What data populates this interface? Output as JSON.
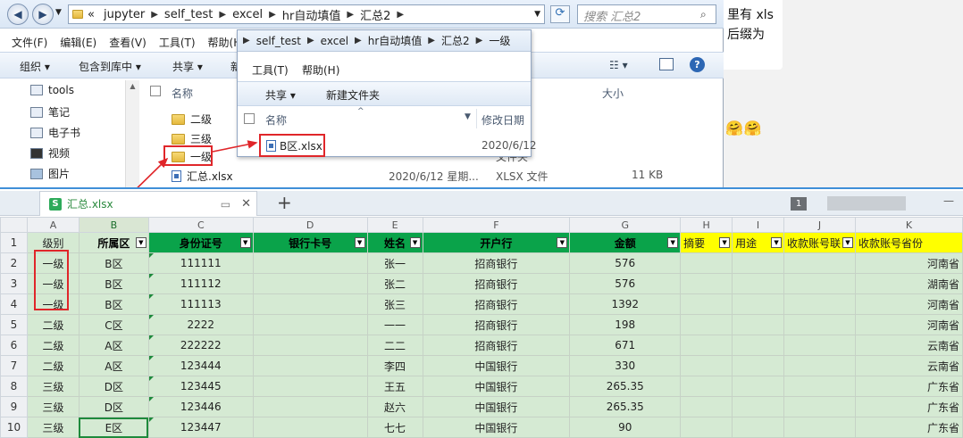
{
  "chat": {
    "bubble_lines": [
      "里有 xls",
      "后缀为"
    ],
    "emojis": "🤗🤗"
  },
  "explorer": {
    "address_prefix": "«",
    "breadcrumbs": [
      "jupyter",
      "self_test",
      "excel",
      "hr自动填值",
      "汇总2"
    ],
    "search_placeholder": "搜索 汇总2",
    "menu": [
      "文件(F)",
      "编辑(E)",
      "查看(V)",
      "工具(T)",
      "帮助(H)"
    ],
    "toolbar": [
      "组织 ▾",
      "包含到库中 ▾",
      "共享 ▾",
      "新"
    ],
    "nav_items": [
      "tools",
      "笔记",
      "电子书",
      "视频",
      "图片"
    ],
    "columns": {
      "name": "名称",
      "size": "大小"
    },
    "files": [
      {
        "name": "二级",
        "type": "folder",
        "date": "",
        "kind": "",
        "size": ""
      },
      {
        "name": "三级",
        "type": "folder",
        "date": "",
        "kind": "",
        "size": ""
      },
      {
        "name": "一级",
        "type": "folder",
        "date": "",
        "kind": "文件夹",
        "size": ""
      },
      {
        "name": "汇总.xlsx",
        "type": "xlsx",
        "date": "2020/6/12 星期...",
        "kind": "XLSX 文件",
        "size": "11 KB"
      }
    ]
  },
  "explorer2": {
    "breadcrumbs": [
      "self_test",
      "excel",
      "hr自动填值",
      "汇总2",
      "一级"
    ],
    "menu": [
      "工具(T)",
      "帮助(H)"
    ],
    "toolbar": [
      "共享 ▾",
      "新建文件夹"
    ],
    "columns": {
      "name": "名称",
      "date": "修改日期"
    },
    "file": {
      "name": "B区.xlsx",
      "date": "2020/6/12"
    }
  },
  "wps": {
    "tab_label": "汇总.xlsx",
    "add_tab": "+",
    "page_badge": "1",
    "col_letters": [
      "A",
      "B",
      "C",
      "D",
      "E",
      "F",
      "G",
      "H",
      "I",
      "J",
      "K"
    ],
    "headers": [
      "级别",
      "所属区",
      "身份证号",
      "银行卡号",
      "姓名",
      "开户行",
      "金额",
      "摘要",
      "用途",
      "收款账号联",
      "收款账号省份"
    ],
    "rows": [
      [
        "一级",
        "B区",
        "111111",
        "",
        "张一",
        "招商银行",
        "576",
        "",
        "",
        "",
        "河南省"
      ],
      [
        "一级",
        "B区",
        "111112",
        "",
        "张二",
        "招商银行",
        "576",
        "",
        "",
        "",
        "湖南省"
      ],
      [
        "一级",
        "B区",
        "111113",
        "",
        "张三",
        "招商银行",
        "1392",
        "",
        "",
        "",
        "河南省"
      ],
      [
        "二级",
        "C区",
        "2222",
        "",
        "一一",
        "招商银行",
        "198",
        "",
        "",
        "",
        "河南省"
      ],
      [
        "二级",
        "A区",
        "222222",
        "",
        "二二",
        "招商银行",
        "671",
        "",
        "",
        "",
        "云南省"
      ],
      [
        "二级",
        "A区",
        "123444",
        "",
        "李四",
        "中国银行",
        "330",
        "",
        "",
        "",
        "云南省"
      ],
      [
        "三级",
        "D区",
        "123445",
        "",
        "王五",
        "中国银行",
        "265.35",
        "",
        "",
        "",
        "广东省"
      ],
      [
        "三级",
        "D区",
        "123446",
        "",
        "赵六",
        "中国银行",
        "265.35",
        "",
        "",
        "",
        "广东省"
      ],
      [
        "三级",
        "E区",
        "123447",
        "",
        "七七",
        "中国银行",
        "90",
        "",
        "",
        "",
        "广东省"
      ]
    ]
  }
}
